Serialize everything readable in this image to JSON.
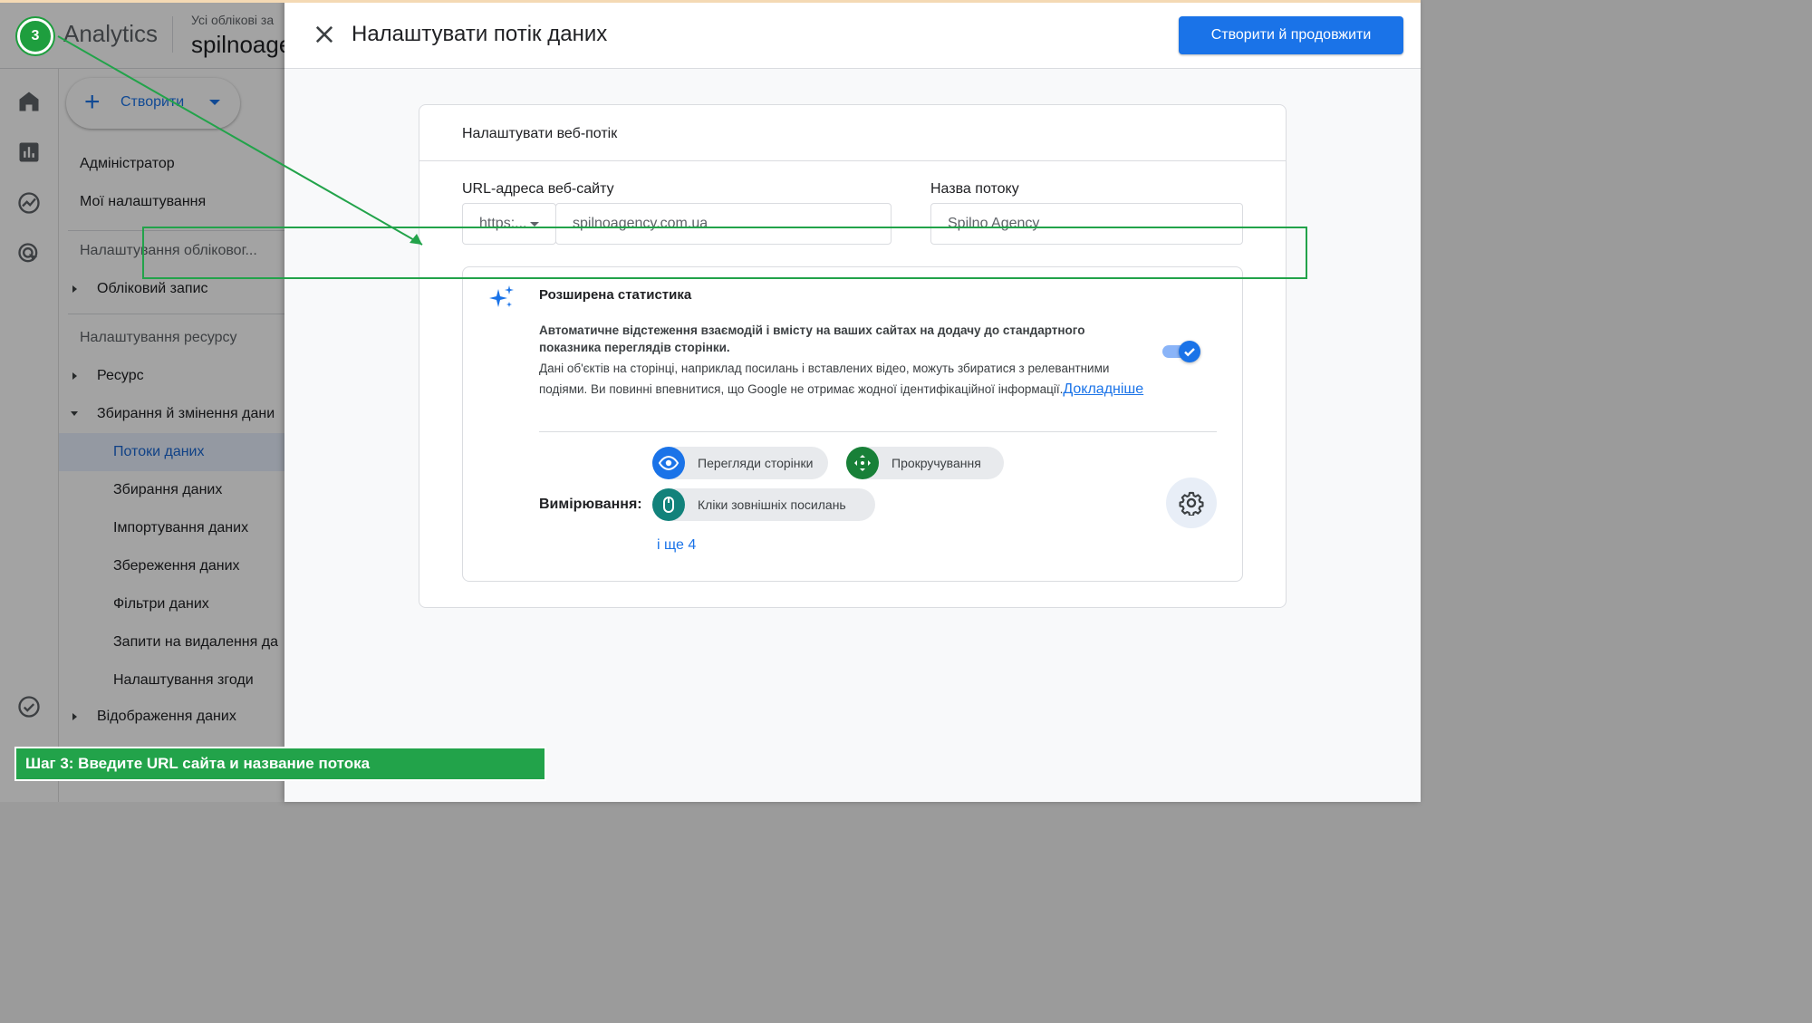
{
  "app": {
    "product_name": "Analytics",
    "account_subtitle": "Усі облікові за",
    "account_name": "spilnoage"
  },
  "sidebar": {
    "create_label": "Створити",
    "items": [
      {
        "label": "Адміністратор"
      },
      {
        "label": "Мої налаштування"
      },
      {
        "label": "Налаштування обліковог..."
      },
      {
        "label": "Обліковий запис"
      },
      {
        "label": "Налаштування ресурсу"
      },
      {
        "label": "Ресурс"
      },
      {
        "label": "Збирання й змінення дани"
      },
      {
        "label": "Потоки даних"
      },
      {
        "label": "Збирання даних"
      },
      {
        "label": "Імпортування даних"
      },
      {
        "label": "Збереження даних"
      },
      {
        "label": "Фільтри даних"
      },
      {
        "label": "Запити на видалення да"
      },
      {
        "label": "Налаштування згоди"
      },
      {
        "label": "Відображення даних"
      }
    ]
  },
  "dialog": {
    "title": "Налаштувати потік даних",
    "primary_button": "Створити й продовжити",
    "card_title": "Налаштувати веб-потік",
    "url_label": "URL-адреса веб-сайту",
    "protocol_value": "https:...",
    "url_value": "spilnoagency.com.ua",
    "stream_name_label": "Назва потоку",
    "stream_name_value": "Spilno Agency",
    "enhanced": {
      "title": "Розширена статистика",
      "desc_bold": "Автоматичне відстеження взаємодій і вмісту на ваших сайтах на додачу до стандартного показника переглядів сторінки.",
      "desc": "Дані об'єктів на сторінці, наприклад посилань і вставлених відео, можуть збиратися з релевантними подіями. Ви повинні впевнитися, що Google не отримає жодної ідентифікаційної інформації.",
      "learn_more": "Докладніше",
      "toggle_on": true,
      "measurement_label": "Вимірювання:",
      "chips": [
        {
          "label": "Перегляди сторінки",
          "icon": "eye-icon",
          "color": "#1a73e8"
        },
        {
          "label": "Прокручування",
          "icon": "scroll-arrows-icon",
          "color": "#188038"
        },
        {
          "label": "Кліки зовнішніх посилань",
          "icon": "mouse-icon",
          "color": "#12827b"
        }
      ],
      "more_link": "і ще 4"
    }
  },
  "tutorial": {
    "step_number": "3",
    "caption": "Шаг 3: Введите URL сайта и название потока",
    "accent_color": "#22a34a"
  }
}
